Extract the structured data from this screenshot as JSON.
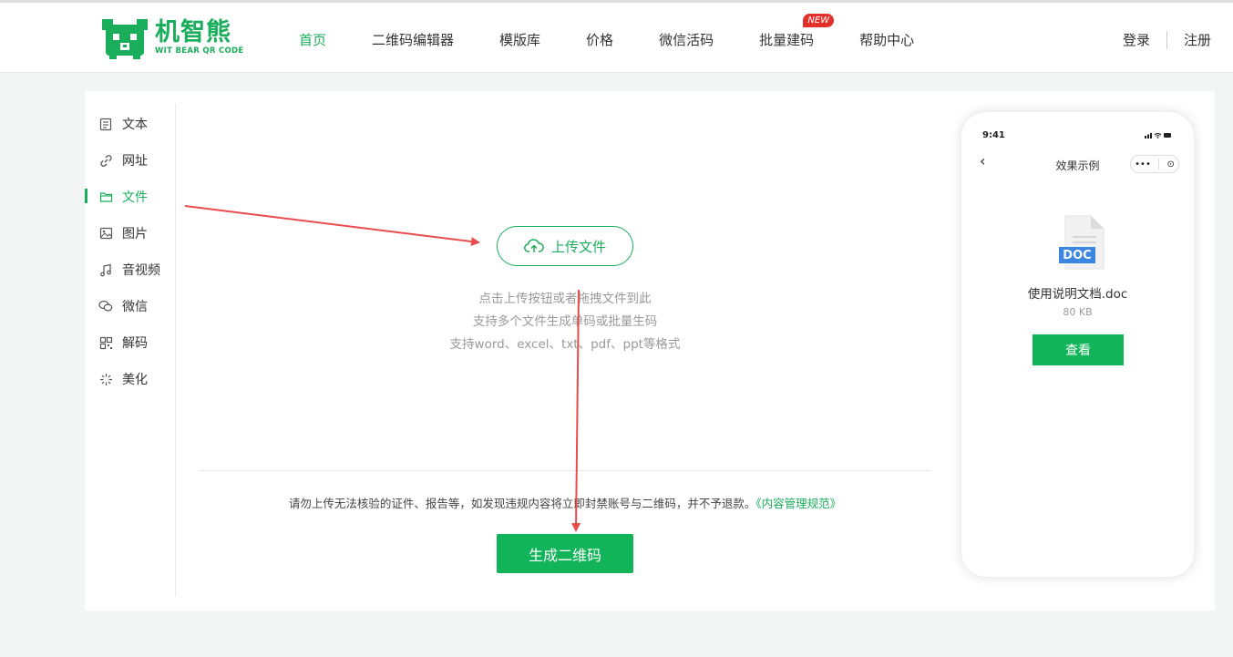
{
  "brand": {
    "name_cn": "机智熊",
    "name_en": "WIT BEAR QR CODE",
    "color": "#1aad5b"
  },
  "nav": {
    "items": [
      {
        "label": "首页",
        "active": true
      },
      {
        "label": "二维码编辑器"
      },
      {
        "label": "模版库"
      },
      {
        "label": "价格"
      },
      {
        "label": "微信活码"
      },
      {
        "label": "批量建码",
        "badge": "NEW"
      },
      {
        "label": "帮助中心"
      }
    ],
    "login": "登录",
    "register": "注册"
  },
  "sidebar": {
    "items": [
      {
        "label": "文本",
        "icon": "text-doc-icon"
      },
      {
        "label": "网址",
        "icon": "link-icon"
      },
      {
        "label": "文件",
        "icon": "folder-icon",
        "active": true
      },
      {
        "label": "图片",
        "icon": "image-icon"
      },
      {
        "label": "音视频",
        "icon": "music-icon"
      },
      {
        "label": "微信",
        "icon": "wechat-icon"
      },
      {
        "label": "解码",
        "icon": "qr-grid-icon"
      },
      {
        "label": "美化",
        "icon": "sparkle-icon"
      }
    ]
  },
  "upload": {
    "button_label": "上传文件",
    "hints": [
      "点击上传按钮或者拖拽文件到此",
      "支持多个文件生成单码或批量生码",
      "支持word、excel、txt、pdf、ppt等格式"
    ]
  },
  "notice": {
    "text": "请勿上传无法核验的证件、报告等，如发现违规内容将立即封禁账号与二维码，并不予退款。",
    "link": "《内容管理规范》"
  },
  "generate_button": "生成二维码",
  "preview": {
    "time": "9:41",
    "title": "效果示例",
    "doc_badge": "DOC",
    "file_name": "使用说明文档.doc",
    "file_size": "80 KB",
    "view_button": "查看"
  },
  "colors": {
    "accent": "#12b459",
    "annotation": "#e84c4c",
    "badge": "#e4302b"
  }
}
